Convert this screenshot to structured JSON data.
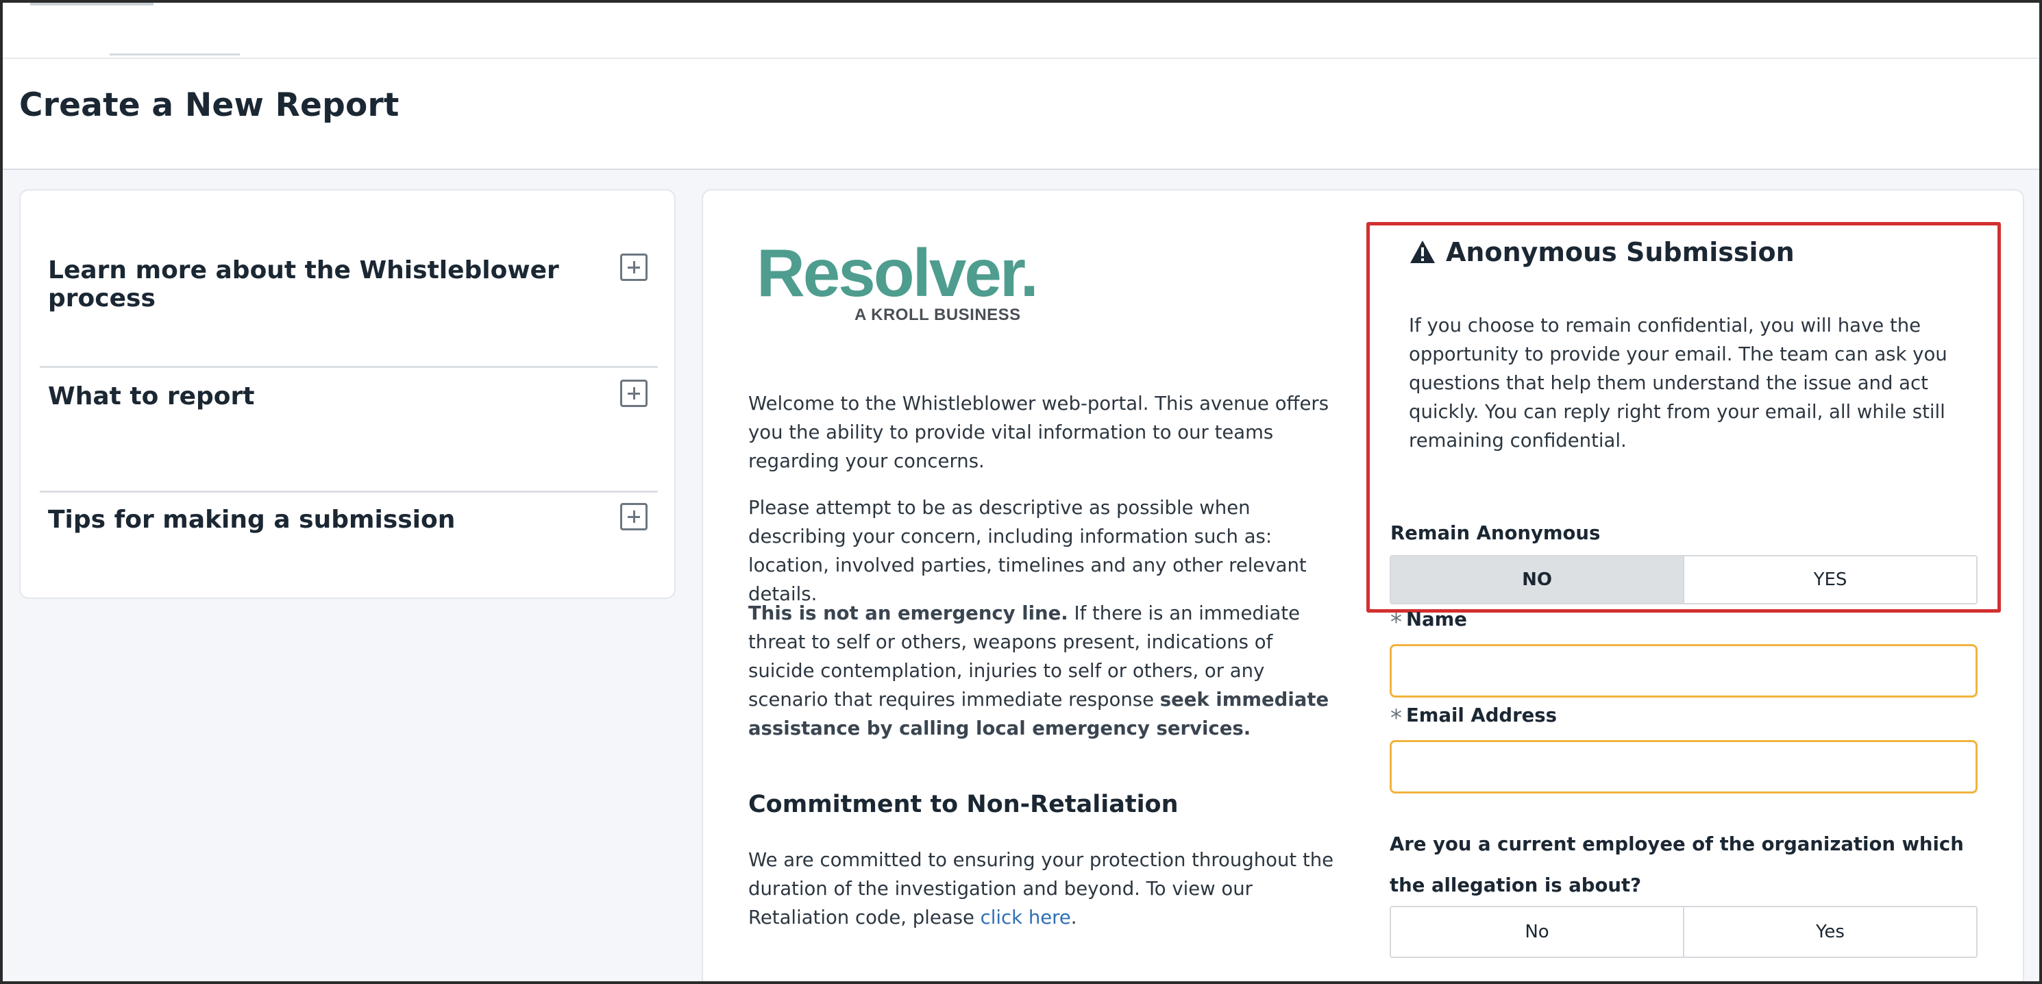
{
  "page": {
    "title": "Create a New Report"
  },
  "sidebar": {
    "items": [
      {
        "label": "Learn more about the Whistleblower process"
      },
      {
        "label": "What to report"
      },
      {
        "label": "Tips for making a submission"
      }
    ]
  },
  "brand": {
    "logo_text": "Resolver.",
    "logo_subtext": "A KROLL BUSINESS",
    "logo_color": "#4e9d8f"
  },
  "intro": {
    "welcome": "Welcome to the Whistleblower web-portal. This avenue offers you the ability to provide vital information to our teams regarding your concerns.",
    "descriptive": "Please attempt to be as descriptive as possible when describing your concern, including information such as: location, involved parties, timelines and any other relevant details.",
    "emergency_bold": "This is not an emergency line.",
    "emergency_text": " If there is an immediate threat to self or others, weapons present, indications of suicide contemplation, injuries to self or others, or any scenario that requires immediate response ",
    "emergency_bold_end": "seek immediate assistance by calling local emergency services."
  },
  "retaliation": {
    "heading": "Commitment to Non-Retaliation",
    "text": "We are committed to ensuring your protection throughout the duration of the investigation and beyond. To view our Retaliation code, please ",
    "link_label": "click here",
    "text_end": "."
  },
  "anonymous": {
    "title": "Anonymous Submission",
    "description": "If you choose to remain confidential, you will have the opportunity to provide your email. The team can ask you questions that help them understand the issue and act quickly. You can reply right from your email, all while still remaining confidential.",
    "remain_label": "Remain Anonymous",
    "options": [
      "NO",
      "YES"
    ],
    "selected": "NO"
  },
  "form": {
    "name_label": "Name",
    "name_value": "",
    "email_label": "Email Address",
    "email_value": "",
    "required_marker": "*",
    "employee_question": "Are you a current employee of the organization which the allegation is about?",
    "employee_options": [
      "No",
      "Yes"
    ]
  },
  "colors": {
    "highlight_border": "#d32f2f",
    "input_border": "#f1b33d",
    "link": "#2f6fb3"
  }
}
